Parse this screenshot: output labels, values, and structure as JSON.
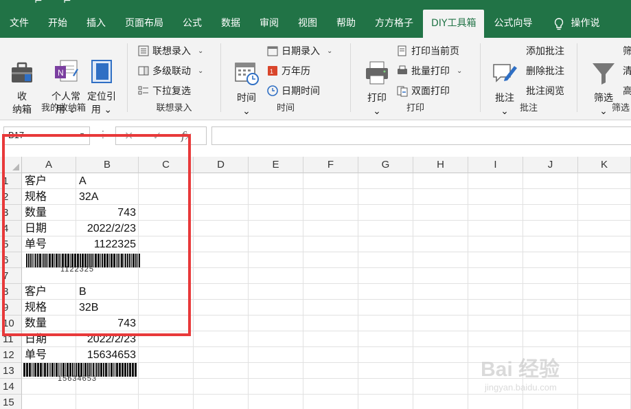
{
  "tabs": [
    {
      "label": "文件",
      "active": false
    },
    {
      "label": "开始",
      "active": false
    },
    {
      "label": "插入",
      "active": false
    },
    {
      "label": "页面布局",
      "active": false
    },
    {
      "label": "公式",
      "active": false
    },
    {
      "label": "数据",
      "active": false
    },
    {
      "label": "审阅",
      "active": false
    },
    {
      "label": "视图",
      "active": false
    },
    {
      "label": "帮助",
      "active": false
    },
    {
      "label": "方方格子",
      "active": false
    },
    {
      "label": "DIY工具箱",
      "active": true
    },
    {
      "label": "公式向导",
      "active": false
    }
  ],
  "help_search": "操作说",
  "ribbon": {
    "groups": {
      "collect": "我的收纳箱",
      "assoc": "联想录入",
      "time": "时间",
      "print": "打印",
      "comment": "批注",
      "filter": "筛选"
    },
    "collect_box": "收\n纳箱",
    "personal": "个人常\n用 ⌄",
    "locate": "定位引\n用 ⌄",
    "assoc_input": "联想录入",
    "multi_link": "多级联动",
    "dropdown_multi": "下拉复选",
    "time_btn": "时间\n⌄",
    "date_input": "日期录入",
    "calendar": "万年历",
    "date_time": "日期时间",
    "print_btn": "打印\n⌄",
    "print_current": "打印当前页",
    "batch_print": "批量打印",
    "duplex_print": "双面打印",
    "comment_btn": "批注\n⌄",
    "add_comment": "添加批注",
    "delete_comment": "删除批注",
    "browse_comment": "批注阅览",
    "filter_btn": "筛选\n⌄",
    "filter_a": "筛",
    "filter_b": "清",
    "filter_c": "高"
  },
  "formula_bar": {
    "name_box": "B17",
    "formula": ""
  },
  "columns": [
    "A",
    "B",
    "C",
    "D",
    "E",
    "F",
    "G",
    "H",
    "I",
    "J",
    "K"
  ],
  "rows": [
    "1",
    "2",
    "3",
    "4",
    "5",
    "6",
    "7",
    "8",
    "9",
    "10",
    "11",
    "12",
    "13",
    "14",
    "15"
  ],
  "cells": {
    "a1": "客户",
    "b1": "A",
    "a2": "规格",
    "b2": "32A",
    "a3": "数量",
    "b3": "743",
    "a4": "日期",
    "b4": "2022/2/23",
    "a5": "单号",
    "b5": "1122325",
    "a8": "客户",
    "b8": "B",
    "a9": "规格",
    "b9": "32B",
    "a10": "数量",
    "b10": "743",
    "a11": "日期",
    "b11": "2022/2/23",
    "a12": "单号",
    "b12": "15634653"
  },
  "barcodes": {
    "bc1": "1122325",
    "bc2": "15634653"
  },
  "watermark": {
    "main": "Bai 经验",
    "sub": "jingyan.baidu.com"
  },
  "colors": {
    "excel_green": "#217346",
    "highlight_red": "#e8393a"
  }
}
